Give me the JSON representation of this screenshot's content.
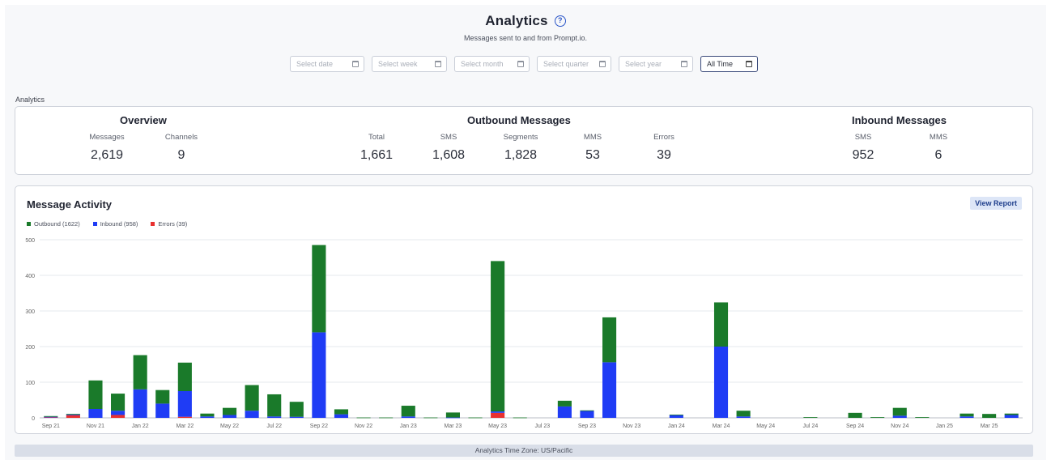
{
  "header": {
    "title": "Analytics",
    "subtitle": "Messages sent to and from Prompt.io.",
    "help_icon": "question-circle-icon"
  },
  "filters": [
    {
      "label": "Select date",
      "icon": "calendar-icon",
      "active": false
    },
    {
      "label": "Select week",
      "icon": "calendar-icon",
      "active": false
    },
    {
      "label": "Select month",
      "icon": "calendar-icon",
      "active": false
    },
    {
      "label": "Select quarter",
      "icon": "calendar-icon",
      "active": false
    },
    {
      "label": "Select year",
      "icon": "calendar-icon",
      "active": false
    },
    {
      "label": "All Time",
      "icon": "calendar-icon",
      "active": true
    }
  ],
  "section_label": "Analytics",
  "overview": {
    "title": "Overview",
    "stats": [
      {
        "label": "Messages",
        "value": "2,619"
      },
      {
        "label": "Channels",
        "value": "9"
      }
    ]
  },
  "outbound": {
    "title": "Outbound Messages",
    "stats": [
      {
        "label": "Total",
        "value": "1,661"
      },
      {
        "label": "SMS",
        "value": "1,608"
      },
      {
        "label": "Segments",
        "value": "1,828"
      },
      {
        "label": "MMS",
        "value": "53"
      },
      {
        "label": "Errors",
        "value": "39"
      }
    ]
  },
  "inbound": {
    "title": "Inbound Messages",
    "stats": [
      {
        "label": "SMS",
        "value": "952"
      },
      {
        "label": "MMS",
        "value": "6"
      }
    ]
  },
  "activity": {
    "title": "Message Activity",
    "view_report_label": "View Report"
  },
  "footer": {
    "timezone_text": "Analytics Time Zone: US/Pacific"
  },
  "colors": {
    "outbound": "#1a7a2a",
    "inbound": "#1f3cf5",
    "errors": "#e8302f",
    "accent": "#2a55c8"
  },
  "chart_data": {
    "type": "bar",
    "stacked": true,
    "ylim": [
      0,
      500
    ],
    "yticks": [
      0,
      100,
      200,
      300,
      400,
      500
    ],
    "grid": true,
    "legend_position": "top-left",
    "tick_labels": [
      "Sep 21",
      "Nov 21",
      "Jan 22",
      "Mar 22",
      "May 22",
      "Jul 22",
      "Sep 22",
      "Nov 22",
      "Jan 23",
      "Mar 23",
      "May 23",
      "Jul 23",
      "Sep 23",
      "Nov 23",
      "Jan 24",
      "Mar 24",
      "May 24",
      "Jul 24",
      "Sep 24",
      "Nov 24",
      "Jan 25",
      "Mar 25"
    ],
    "categories": [
      "Sep 21",
      "Oct 21",
      "Nov 21",
      "Dec 21",
      "Jan 22",
      "Feb 22",
      "Mar 22",
      "Apr 22",
      "May 22",
      "Jun 22",
      "Jul 22",
      "Aug 22",
      "Sep 22",
      "Oct 22",
      "Nov 22",
      "Dec 22",
      "Jan 23",
      "Feb 23",
      "Mar 23",
      "Apr 23",
      "May 23",
      "Jun 23",
      "Jul 23",
      "Aug 23",
      "Sep 23",
      "Oct 23",
      "Nov 23",
      "Dec 23",
      "Jan 24",
      "Feb 24",
      "Mar 24",
      "Apr 24",
      "May 24",
      "Jun 24",
      "Jul 24",
      "Aug 24",
      "Sep 24",
      "Oct 24",
      "Nov 24",
      "Dec 24",
      "Jan 25",
      "Feb 25",
      "Mar 25",
      "Apr 25"
    ],
    "series": [
      {
        "name": "Errors (39)",
        "key": "errors",
        "values": [
          2,
          8,
          0,
          8,
          0,
          0,
          3,
          0,
          0,
          0,
          0,
          0,
          0,
          0,
          0,
          0,
          0,
          0,
          0,
          0,
          14,
          0,
          0,
          0,
          0,
          0,
          0,
          0,
          0,
          0,
          0,
          0,
          0,
          0,
          0,
          0,
          0,
          0,
          0,
          0,
          0,
          0,
          0,
          0
        ]
      },
      {
        "name": "Inbound (958)",
        "key": "inbound",
        "values": [
          1,
          1,
          25,
          12,
          80,
          40,
          72,
          4,
          8,
          20,
          4,
          3,
          240,
          10,
          0,
          0,
          4,
          0,
          1,
          0,
          4,
          0,
          0,
          32,
          20,
          156,
          0,
          0,
          8,
          0,
          200,
          4,
          0,
          0,
          0,
          0,
          0,
          0,
          6,
          0,
          0,
          4,
          0,
          8
        ]
      },
      {
        "name": "Outbound (1622)",
        "key": "outbound",
        "values": [
          2,
          2,
          80,
          48,
          96,
          38,
          80,
          8,
          20,
          72,
          62,
          42,
          245,
          14,
          1,
          1,
          30,
          1,
          14,
          1,
          422,
          1,
          0,
          16,
          1,
          126,
          0,
          0,
          1,
          0,
          124,
          16,
          0,
          0,
          2,
          0,
          14,
          2,
          22,
          2,
          0,
          8,
          11,
          4
        ]
      }
    ]
  }
}
